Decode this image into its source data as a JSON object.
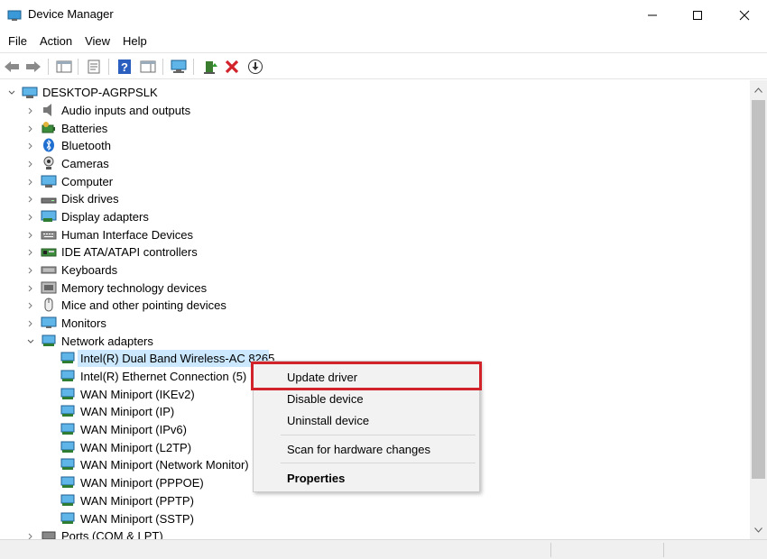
{
  "window": {
    "title": "Device Manager",
    "colors": {
      "accent": "#0078d7",
      "highlight_border": "#d2232a",
      "selection": "#cce8ff"
    }
  },
  "menu": [
    "File",
    "Action",
    "View",
    "Help"
  ],
  "toolbar": {
    "icons": [
      "back-arrow-icon",
      "forward-arrow-icon",
      "show-hide-console-tree-icon",
      "properties-sheet-icon",
      "help-icon",
      "action-pane-icon",
      "monitor-scan-icon",
      "update-driver-icon",
      "uninstall-icon",
      "download-icon"
    ]
  },
  "tree": {
    "root": "DESKTOP-AGRPSLK",
    "categories": [
      "Audio inputs and outputs",
      "Batteries",
      "Bluetooth",
      "Cameras",
      "Computer",
      "Disk drives",
      "Display adapters",
      "Human Interface Devices",
      "IDE ATA/ATAPI controllers",
      "Keyboards",
      "Memory technology devices",
      "Mice and other pointing devices",
      "Monitors",
      "Network adapters"
    ],
    "network_children": [
      "Intel(R) Dual Band Wireless-AC 8265",
      "Intel(R) Ethernet Connection (5) I2",
      "WAN Miniport (IKEv2)",
      "WAN Miniport (IP)",
      "WAN Miniport (IPv6)",
      "WAN Miniport (L2TP)",
      "WAN Miniport (Network Monitor)",
      "WAN Miniport (PPPOE)",
      "WAN Miniport (PPTP)",
      "WAN Miniport (SSTP)"
    ],
    "after": "Ports (COM & LPT)"
  },
  "context_menu": {
    "update_driver": "Update driver",
    "disable_device": "Disable device",
    "uninstall_device": "Uninstall device",
    "scan": "Scan for hardware changes",
    "properties": "Properties"
  }
}
